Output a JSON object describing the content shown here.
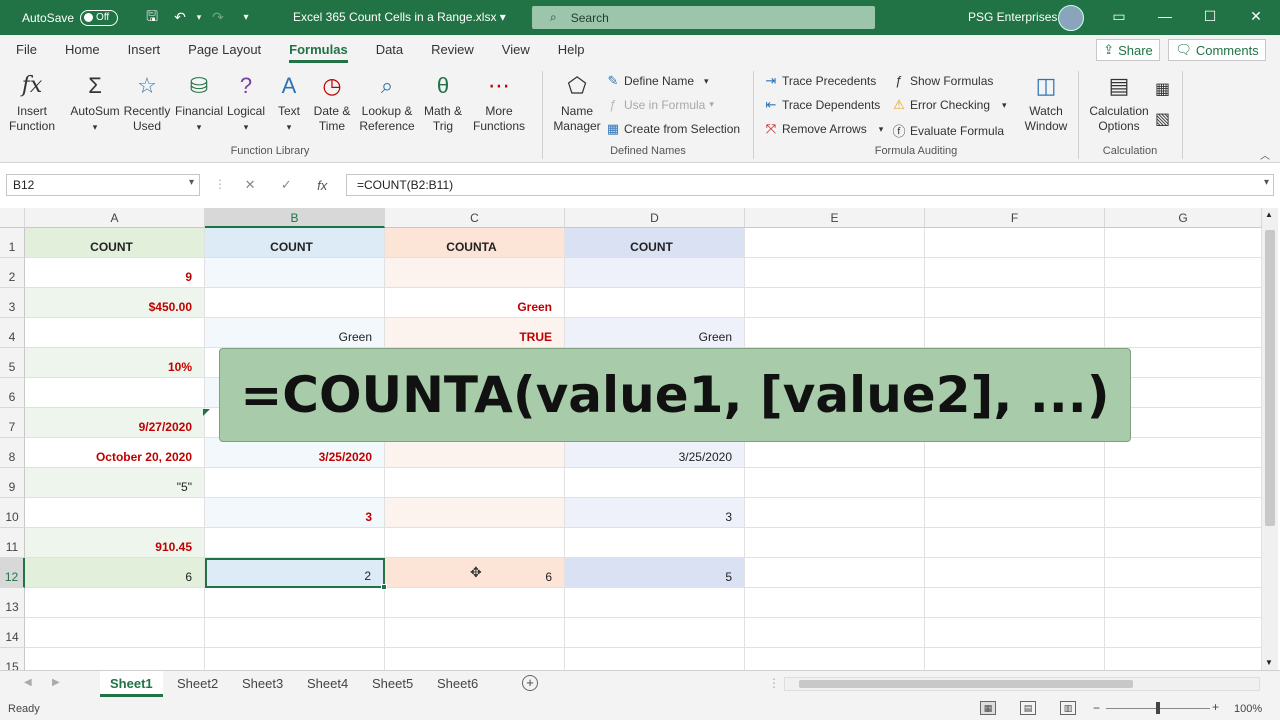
{
  "titlebar": {
    "autosave_label": "AutoSave",
    "autosave_state": "Off",
    "file_name": "Excel 365 Count Cells in a Range.xlsx",
    "search_placeholder": "Search",
    "user_name": "PSG Enterprises"
  },
  "menu": {
    "items": [
      "File",
      "Home",
      "Insert",
      "Page Layout",
      "Formulas",
      "Data",
      "Review",
      "View",
      "Help"
    ],
    "active": "Formulas",
    "share_label": "Share",
    "comments_label": "Comments"
  },
  "ribbon": {
    "insert_function": "Insert\nFunction",
    "autosum": "AutoSum",
    "recently_used": "Recently\nUsed",
    "financial": "Financial",
    "logical": "Logical",
    "text": "Text",
    "date_time": "Date &\nTime",
    "lookup_reference": "Lookup &\nReference",
    "math_trig": "Math &\nTrig",
    "more_functions": "More\nFunctions",
    "function_library_label": "Function Library",
    "name_manager": "Name\nManager",
    "define_name": "Define Name",
    "use_in_formula": "Use in Formula",
    "create_from_selection": "Create from Selection",
    "defined_names_label": "Defined Names",
    "trace_precedents": "Trace Precedents",
    "trace_dependents": "Trace Dependents",
    "remove_arrows": "Remove Arrows",
    "show_formulas": "Show Formulas",
    "error_checking": "Error Checking",
    "evaluate_formula": "Evaluate Formula",
    "watch_window": "Watch\nWindow",
    "formula_auditing_label": "Formula Auditing",
    "calculation_options": "Calculation\nOptions",
    "calculation_label": "Calculation"
  },
  "formula_bar": {
    "name_box": "B12",
    "formula": "=COUNT(B2:B11)"
  },
  "sheet": {
    "columns": [
      "A",
      "B",
      "C",
      "D",
      "E",
      "F",
      "G"
    ],
    "selected_column": "B",
    "rows": [
      "1",
      "2",
      "3",
      "4",
      "5",
      "6",
      "7",
      "8",
      "9",
      "10",
      "11",
      "12",
      "13",
      "14",
      "15"
    ],
    "selected_row": "12",
    "headers": [
      "COUNT",
      "COUNT",
      "COUNTA",
      "COUNT"
    ],
    "col_a": [
      "",
      "9",
      "$450.00",
      "",
      "10%",
      "",
      "9/27/2020",
      "October 20, 2020",
      "\"5\"",
      "",
      "910.45",
      "6"
    ],
    "col_b": [
      "",
      "",
      "",
      "Green",
      "",
      "",
      "",
      "3/25/2020",
      "",
      "3",
      "",
      "2"
    ],
    "col_c": [
      "",
      "",
      "Green",
      "TRUE",
      "",
      "",
      "",
      "",
      "",
      "",
      "",
      "6"
    ],
    "col_d": [
      "",
      "",
      "",
      "Green",
      "",
      "",
      "",
      "3/25/2020",
      "",
      "3",
      "",
      "5"
    ],
    "overlay_text": "=COUNTA(value1, [value2], ...)",
    "colors": {
      "col_a_fill": "#eef5ec",
      "col_a_total_fill": "#e2efda",
      "col_b_fill": "#ddebf7",
      "col_c_fill": "#fce4d6",
      "col_d_fill": "#d9e1f2",
      "red_text": "#c00000",
      "accent": "#217346"
    }
  },
  "tabs": [
    "Sheet1",
    "Sheet2",
    "Sheet3",
    "Sheet4",
    "Sheet5",
    "Sheet6"
  ],
  "active_tab": "Sheet1",
  "status": {
    "ready": "Ready",
    "zoom": "100%"
  }
}
